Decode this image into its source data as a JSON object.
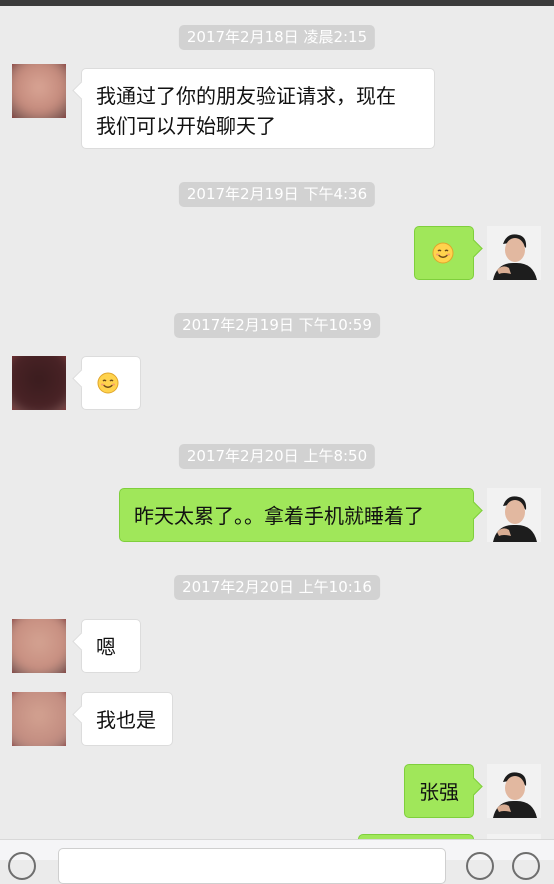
{
  "messages": {
    "ts1": "2017年2月18日 凌晨2:15",
    "m1_line1": "我通过了你的朋友验证请求，现在",
    "m1_line2": "我们可以开始聊天了",
    "ts2": "2017年2月19日 下午4:36",
    "ts3": "2017年2月19日 下午10:59",
    "ts4": "2017年2月20日 上午8:50",
    "m4": "昨天太累了。。拿着手机就睡着了",
    "ts5": "2017年2月20日 上午10:16",
    "m5": "嗯",
    "m6": "我也是",
    "m7": "张强"
  },
  "icons": {
    "emoji": "smiling-face-emoji",
    "voice": "voice-icon",
    "sticker": "emoji-icon",
    "more": "plus-icon"
  },
  "colors": {
    "background": "#ebebeb",
    "bubble_self": "#a0e75a",
    "bubble_other": "#ffffff",
    "timestamp_bg": "#d2d2d2"
  }
}
